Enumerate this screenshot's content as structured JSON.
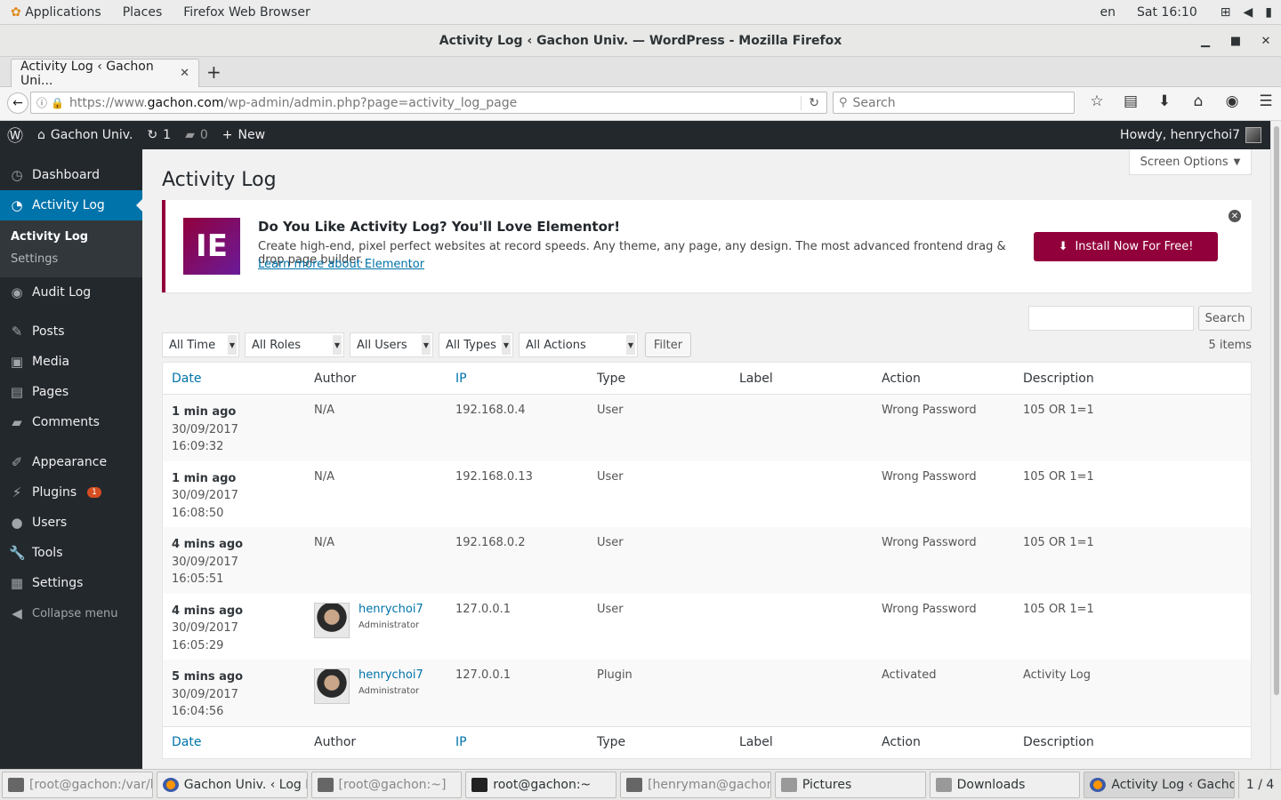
{
  "gnome": {
    "applications": "Applications",
    "places": "Places",
    "app_name": "Firefox Web Browser",
    "lang": "en",
    "clock": "Sat 16:10"
  },
  "window": {
    "title": "Activity Log ‹ Gachon Univ. — WordPress - Mozilla Firefox"
  },
  "browser": {
    "tab_title": "Activity Log ‹ Gachon Uni...",
    "url_prefix": "https://www.",
    "url_host": "gachon.com",
    "url_path": "/wp-admin/admin.php?page=activity_log_page",
    "search_placeholder": "Search"
  },
  "adminbar": {
    "site_name": "Gachon Univ.",
    "updates_count": "1",
    "comments_count": "0",
    "new_label": "New",
    "howdy": "Howdy, henrychoi7"
  },
  "sidebar": {
    "dashboard": "Dashboard",
    "activity_log": "Activity Log",
    "sub_activity_log": "Activity Log",
    "sub_settings": "Settings",
    "audit_log": "Audit Log",
    "posts": "Posts",
    "media": "Media",
    "pages": "Pages",
    "comments": "Comments",
    "appearance": "Appearance",
    "plugins": "Plugins",
    "plugins_badge": "1",
    "users": "Users",
    "tools": "Tools",
    "settings": "Settings",
    "collapse": "Collapse menu"
  },
  "page": {
    "title": "Activity Log",
    "screen_options": "Screen Options"
  },
  "notice": {
    "logo_text": "IE",
    "headline": "Do You Like Activity Log? You'll Love Elementor!",
    "body": "Create high-end, pixel perfect websites at record speeds. Any theme, any page, any design. The most advanced frontend drag & drop page builder.",
    "learn_more": "Learn more about Elementor",
    "install_button": "Install Now For Free!"
  },
  "filters": {
    "time": "All Time",
    "roles": "All Roles",
    "users": "All Users",
    "types": "All Types",
    "actions": "All Actions",
    "filter_button": "Filter",
    "search_button": "Search",
    "items_count": "5 items"
  },
  "table": {
    "headers": {
      "date": "Date",
      "author": "Author",
      "ip": "IP",
      "type": "Type",
      "label": "Label",
      "action": "Action",
      "description": "Description"
    },
    "rows": [
      {
        "ago": "1 min ago",
        "date": "30/09/2017",
        "time": "16:09:32",
        "author": "N/A",
        "ip": "192.168.0.4",
        "type": "User",
        "label": "",
        "action": "Wrong Password",
        "description": "105 OR 1=1"
      },
      {
        "ago": "1 min ago",
        "date": "30/09/2017",
        "time": "16:08:50",
        "author": "N/A",
        "ip": "192.168.0.13",
        "type": "User",
        "label": "",
        "action": "Wrong Password",
        "description": "105 OR 1=1"
      },
      {
        "ago": "4 mins ago",
        "date": "30/09/2017",
        "time": "16:05:51",
        "author": "N/A",
        "ip": "192.168.0.2",
        "type": "User",
        "label": "",
        "action": "Wrong Password",
        "description": "105 OR 1=1"
      },
      {
        "ago": "4 mins ago",
        "date": "30/09/2017",
        "time": "16:05:29",
        "author": "henrychoi7",
        "role": "Administrator",
        "ip": "127.0.0.1",
        "type": "User",
        "label": "",
        "action": "Wrong Password",
        "description": "105 OR 1=1"
      },
      {
        "ago": "5 mins ago",
        "date": "30/09/2017",
        "time": "16:04:56",
        "author": "henrychoi7",
        "role": "Administrator",
        "ip": "127.0.0.1",
        "type": "Plugin",
        "label": "",
        "action": "Activated",
        "description": "Activity Log"
      }
    ]
  },
  "taskbar": {
    "items": [
      "[root@gachon:/var/l...",
      "Gachon Univ. ‹ Log I...",
      "[root@gachon:~]",
      "root@gachon:~",
      "[henryman@gachon:...",
      "Pictures",
      "Downloads",
      "Activity Log ‹ Gacho..."
    ],
    "pager": "1 / 4"
  },
  "colors": {
    "admin_dark": "#23282d",
    "accent_blue": "#0073aa",
    "elementor": "#92003b"
  }
}
